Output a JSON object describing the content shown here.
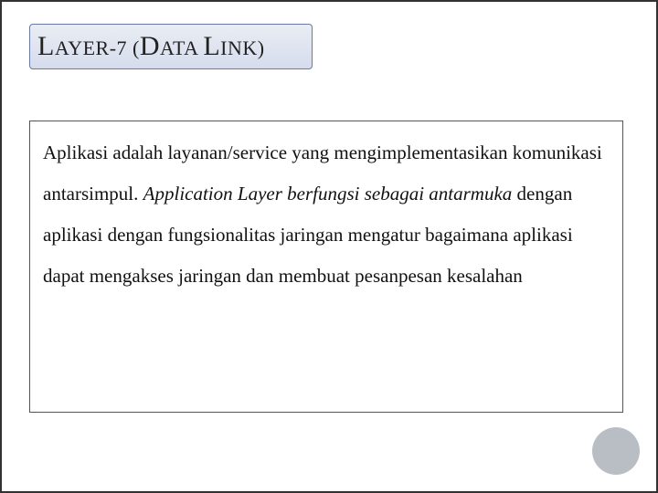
{
  "title": {
    "caps": [
      "L",
      "D",
      "L"
    ],
    "small": [
      "AYER-7 (",
      "ATA ",
      "INK)"
    ]
  },
  "body": {
    "p1": "Aplikasi adalah layanan/service yang mengimplementasikan komunikasi antarsimpul.",
    "p2_italic": "Application Layer berfungsi sebagai antarmuka",
    "p2_tail": " dengan aplikasi dengan fungsionalitas jaringan mengatur bagaimana aplikasi dapat mengakses jaringan dan membuat pesanpesan kesalahan"
  }
}
